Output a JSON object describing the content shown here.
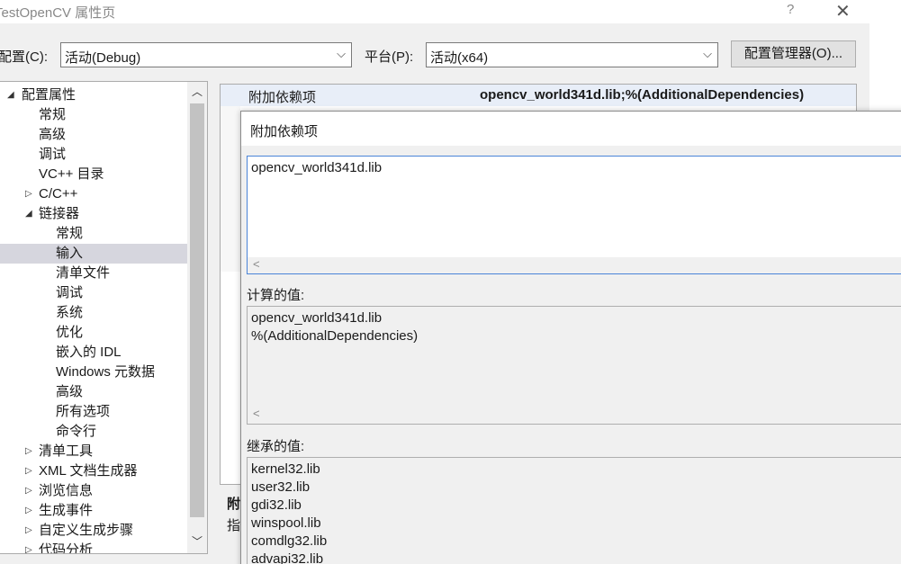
{
  "window": {
    "title": "TestOpenCV 属性页",
    "help_glyph": "?",
    "close_glyph": "✕"
  },
  "config": {
    "config_label": "配置(C):",
    "config_value": "活动(Debug)",
    "platform_label": "平台(P):",
    "platform_value": "活动(x64)",
    "manager_button": "配置管理器(O)..."
  },
  "tree": {
    "items": [
      {
        "label": "配置属性",
        "toggle": "◢",
        "level": 0
      },
      {
        "label": "常规",
        "toggle": "",
        "level": 1
      },
      {
        "label": "高级",
        "toggle": "",
        "level": 1
      },
      {
        "label": "调试",
        "toggle": "",
        "level": 1
      },
      {
        "label": "VC++ 目录",
        "toggle": "",
        "level": 1
      },
      {
        "label": "C/C++",
        "toggle": "▷",
        "level": 1
      },
      {
        "label": "链接器",
        "toggle": "◢",
        "level": 1
      },
      {
        "label": "常规",
        "toggle": "",
        "level": 2
      },
      {
        "label": "输入",
        "toggle": "",
        "level": 2,
        "selected": true
      },
      {
        "label": "清单文件",
        "toggle": "",
        "level": 2
      },
      {
        "label": "调试",
        "toggle": "",
        "level": 2
      },
      {
        "label": "系统",
        "toggle": "",
        "level": 2
      },
      {
        "label": "优化",
        "toggle": "",
        "level": 2
      },
      {
        "label": "嵌入的 IDL",
        "toggle": "",
        "level": 2
      },
      {
        "label": "Windows 元数据",
        "toggle": "",
        "level": 2
      },
      {
        "label": "高级",
        "toggle": "",
        "level": 2
      },
      {
        "label": "所有选项",
        "toggle": "",
        "level": 2
      },
      {
        "label": "命令行",
        "toggle": "",
        "level": 2
      },
      {
        "label": "清单工具",
        "toggle": "▷",
        "level": 1
      },
      {
        "label": "XML 文档生成器",
        "toggle": "▷",
        "level": 1
      },
      {
        "label": "浏览信息",
        "toggle": "▷",
        "level": 1
      },
      {
        "label": "生成事件",
        "toggle": "▷",
        "level": 1
      },
      {
        "label": "自定义生成步骤",
        "toggle": "▷",
        "level": 1
      },
      {
        "label": "代码分析",
        "toggle": "▷",
        "level": 1
      }
    ],
    "scroll_up": "︿",
    "scroll_down": "﹀"
  },
  "grid": {
    "row_name": "附加依赖项",
    "row_value": "opencv_world341d.lib;%(AdditionalDependencies)"
  },
  "description": {
    "title_fragment": "附",
    "body_fragment": "指"
  },
  "popup": {
    "title": "附加依赖项",
    "edit_text": "opencv_world341d.lib",
    "scroll_left": "<",
    "computed_label": "计算的值:",
    "computed_lines": [
      "opencv_world341d.lib",
      "%(AdditionalDependencies)"
    ],
    "inherited_label": "继承的值:",
    "inherited_lines": [
      "kernel32.lib",
      "user32.lib",
      "gdi32.lib",
      "winspool.lib",
      "comdlg32.lib",
      "advapi32.lib"
    ]
  }
}
